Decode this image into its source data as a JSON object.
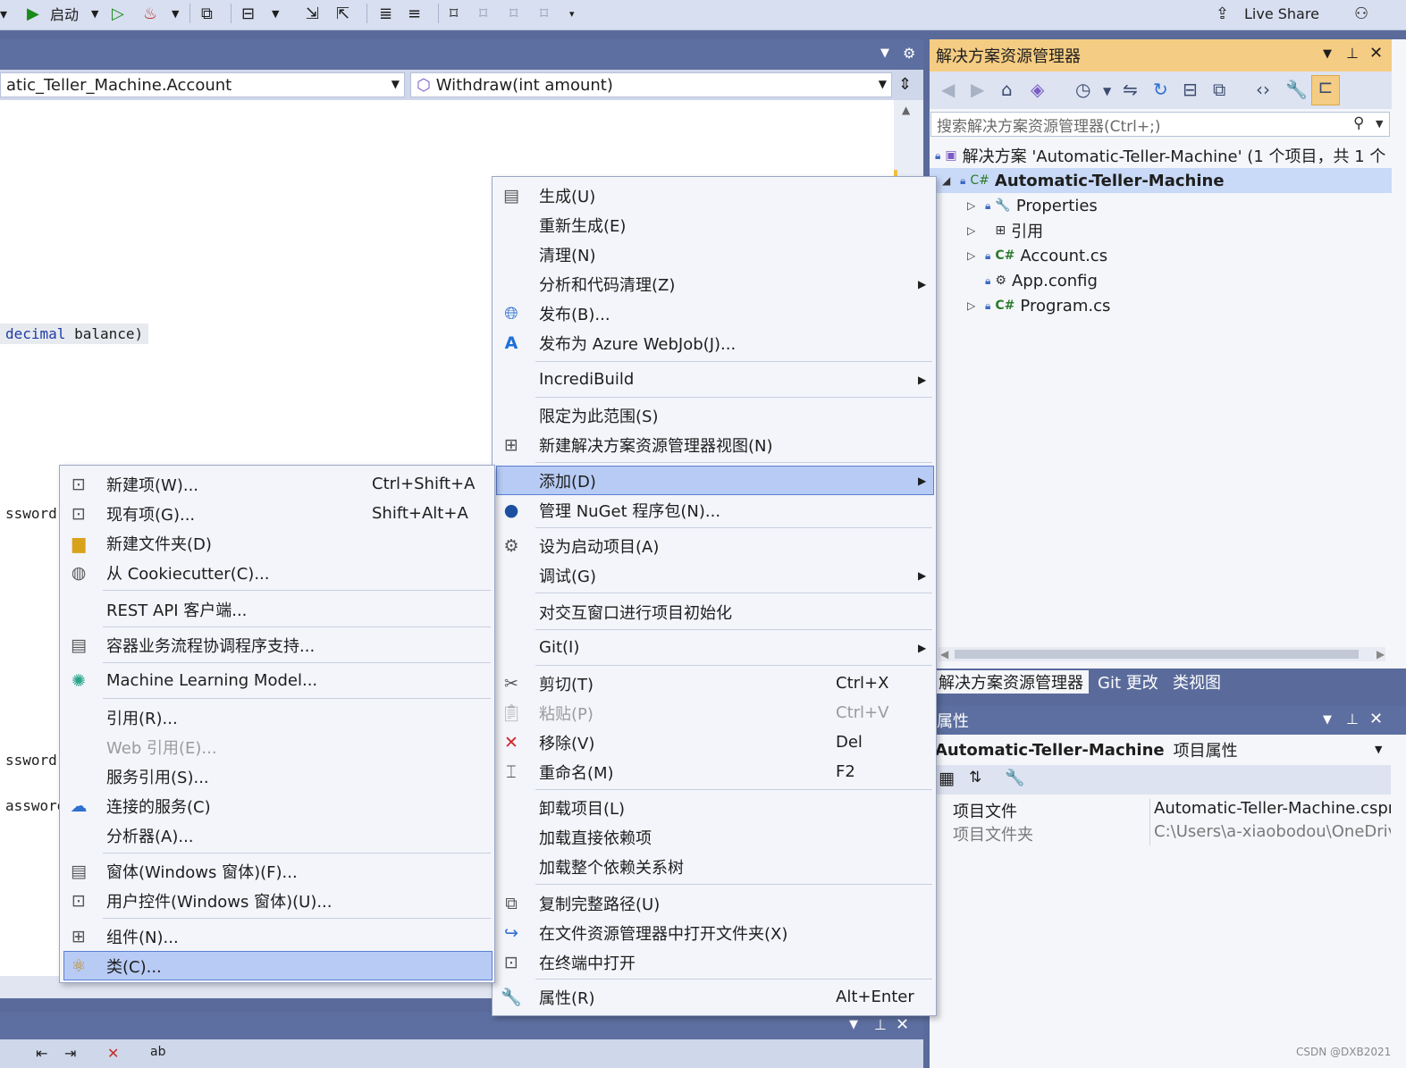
{
  "toolbar": {
    "start_label": "启动",
    "live_share_label": "Live Share"
  },
  "editor": {
    "type_combo": "atic_Teller_Machine.Account",
    "member_combo": "Withdraw(int amount)",
    "code_lines": [
      {
        "kw": "decimal",
        "rest": " balance)"
      },
      {
        "text": "ssword,"
      },
      {
        "text": "ssword)"
      },
      {
        "text": "assword"
      }
    ]
  },
  "solution_explorer": {
    "title": "解决方案资源管理器",
    "search_placeholder": "搜索解决方案资源管理器(Ctrl+;)",
    "tree": [
      {
        "label": "解决方案 'Automatic-Teller-Machine' (1 个项目，共 1 个"
      },
      {
        "label": "Automatic-Teller-Machine"
      },
      {
        "label": "Properties"
      },
      {
        "label": "引用"
      },
      {
        "label": "Account.cs"
      },
      {
        "label": "App.config"
      },
      {
        "label": "Program.cs"
      }
    ],
    "tabs": [
      "解决方案资源管理器",
      "Git 更改",
      "类视图"
    ]
  },
  "properties": {
    "title": "属性",
    "object_name": "Automatic-Teller-Machine",
    "object_type": "项目属性",
    "rows": [
      {
        "key": "项目文件",
        "value": "Automatic-Teller-Machine.cspro"
      },
      {
        "key": "项目文件夹",
        "value": "C:\\Users\\a-xiaobodou\\OneDrive"
      }
    ]
  },
  "project_menu": {
    "items": [
      {
        "label": "生成(U)",
        "icon": "build-icon"
      },
      {
        "label": "重新生成(E)"
      },
      {
        "label": "清理(N)"
      },
      {
        "label": "分析和代码清理(Z)",
        "submenu": true
      },
      {
        "label": "发布(B)...",
        "icon": "globe-icon"
      },
      {
        "label": "发布为 Azure WebJob(J)...",
        "icon": "azure-icon"
      },
      {
        "label": "IncrediBuild",
        "submenu": true
      },
      {
        "label": "限定为此范围(S)"
      },
      {
        "label": "新建解决方案资源管理器视图(N)",
        "icon": "new-view-icon"
      },
      {
        "label": "添加(D)",
        "submenu": true
      },
      {
        "label": "管理 NuGet 程序包(N)...",
        "icon": "nuget-icon"
      },
      {
        "label": "设为启动项目(A)",
        "icon": "gear-icon"
      },
      {
        "label": "调试(G)",
        "submenu": true
      },
      {
        "label": "对交互窗口进行项目初始化"
      },
      {
        "label": "Git(I)",
        "submenu": true
      },
      {
        "label": "剪切(T)",
        "shortcut": "Ctrl+X",
        "icon": "scissors-icon"
      },
      {
        "label": "粘贴(P)",
        "shortcut": "Ctrl+V",
        "icon": "paste-icon"
      },
      {
        "label": "移除(V)",
        "shortcut": "Del",
        "icon": "remove-icon"
      },
      {
        "label": "重命名(M)",
        "shortcut": "F2",
        "icon": "rename-icon"
      },
      {
        "label": "卸载项目(L)"
      },
      {
        "label": "加载直接依赖项"
      },
      {
        "label": "加载整个依赖关系树"
      },
      {
        "label": "复制完整路径(U)",
        "icon": "copy-icon"
      },
      {
        "label": "在文件资源管理器中打开文件夹(X)",
        "icon": "open-folder-icon"
      },
      {
        "label": "在终端中打开",
        "icon": "terminal-icon"
      },
      {
        "label": "属性(R)",
        "shortcut": "Alt+Enter",
        "icon": "wrench-icon"
      }
    ]
  },
  "add_menu": {
    "items": [
      {
        "label": "新建项(W)...",
        "shortcut": "Ctrl+Shift+A",
        "icon": "new-item-icon"
      },
      {
        "label": "现有项(G)...",
        "shortcut": "Shift+Alt+A",
        "icon": "existing-item-icon"
      },
      {
        "label": "新建文件夹(D)",
        "icon": "new-folder-icon"
      },
      {
        "label": "从 Cookiecutter(C)...",
        "icon": "cookiecutter-icon"
      },
      {
        "label": "REST API 客户端..."
      },
      {
        "label": "容器业务流程协调程序支持...",
        "icon": "container-icon"
      },
      {
        "label": "Machine Learning Model...",
        "icon": "ml-icon"
      },
      {
        "label": "引用(R)..."
      },
      {
        "label": "Web 引用(E)..."
      },
      {
        "label": "服务引用(S)..."
      },
      {
        "label": "连接的服务(C)",
        "icon": "connected-service-icon"
      },
      {
        "label": "分析器(A)..."
      },
      {
        "label": "窗体(Windows 窗体)(F)...",
        "icon": "form-icon"
      },
      {
        "label": "用户控件(Windows 窗体)(U)...",
        "icon": "user-control-icon"
      },
      {
        "label": "组件(N)...",
        "icon": "component-icon"
      },
      {
        "label": "类(C)...",
        "icon": "class-icon"
      }
    ]
  },
  "watermark": "CSDN @DXB2021"
}
